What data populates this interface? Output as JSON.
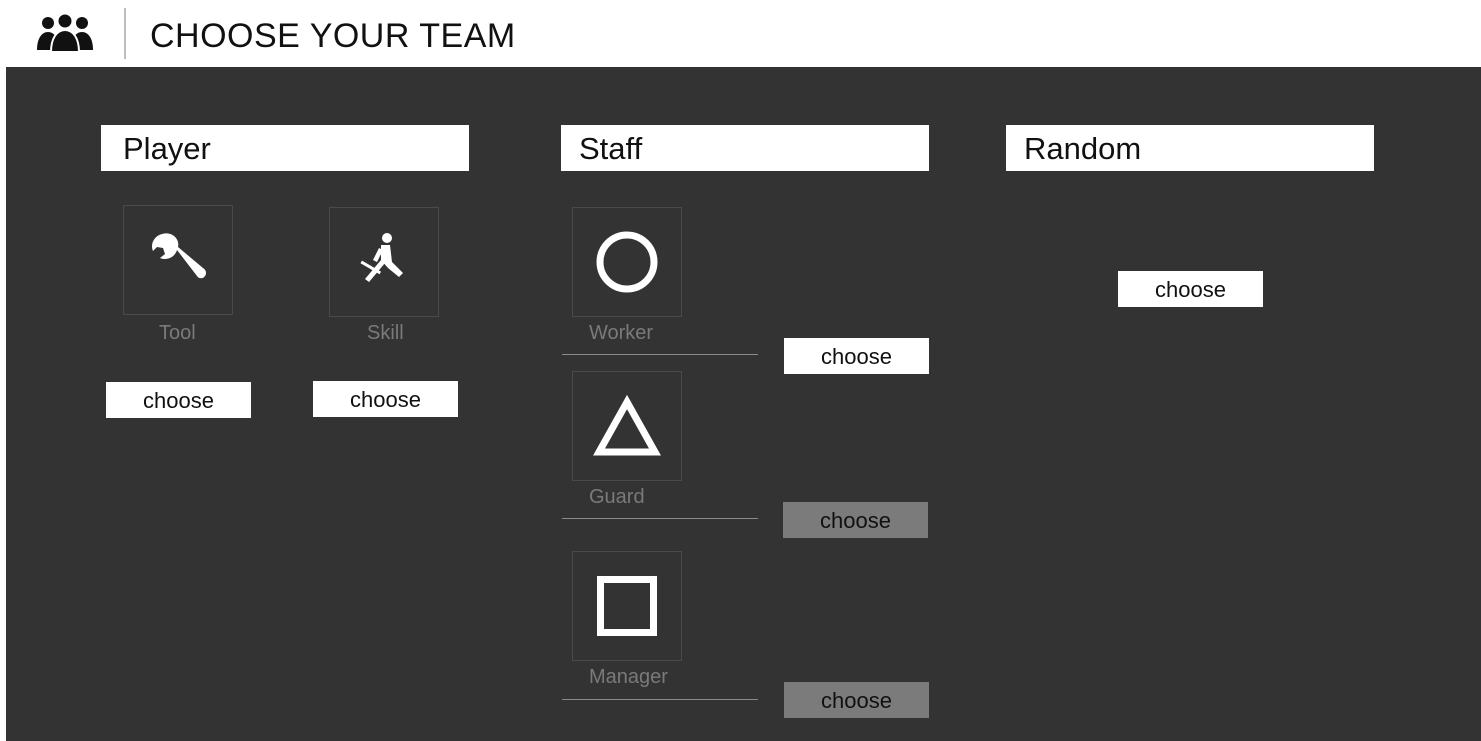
{
  "header": {
    "icon": "team-icon",
    "title": "CHOOSE YOUR TEAM"
  },
  "sections": {
    "player": {
      "title": "Player",
      "tool": {
        "label": "Tool",
        "icon": "wrench-icon",
        "button": "choose"
      },
      "skill": {
        "label": "Skill",
        "icon": "skill-figure-icon",
        "button": "choose"
      }
    },
    "staff": {
      "title": "Staff",
      "worker": {
        "label": "Worker",
        "icon": "circle-icon",
        "button": "choose"
      },
      "guard": {
        "label": "Guard",
        "icon": "triangle-icon",
        "button": "choose"
      },
      "manager": {
        "label": "Manager",
        "icon": "square-icon",
        "button": "choose"
      }
    },
    "random": {
      "title": "Random",
      "button": "choose"
    }
  },
  "colors": {
    "panel_bg": "#333333",
    "button_bg": "#ffffff",
    "button_dim_bg": "#7b7b7b",
    "label_text": "#7a7a7a"
  }
}
